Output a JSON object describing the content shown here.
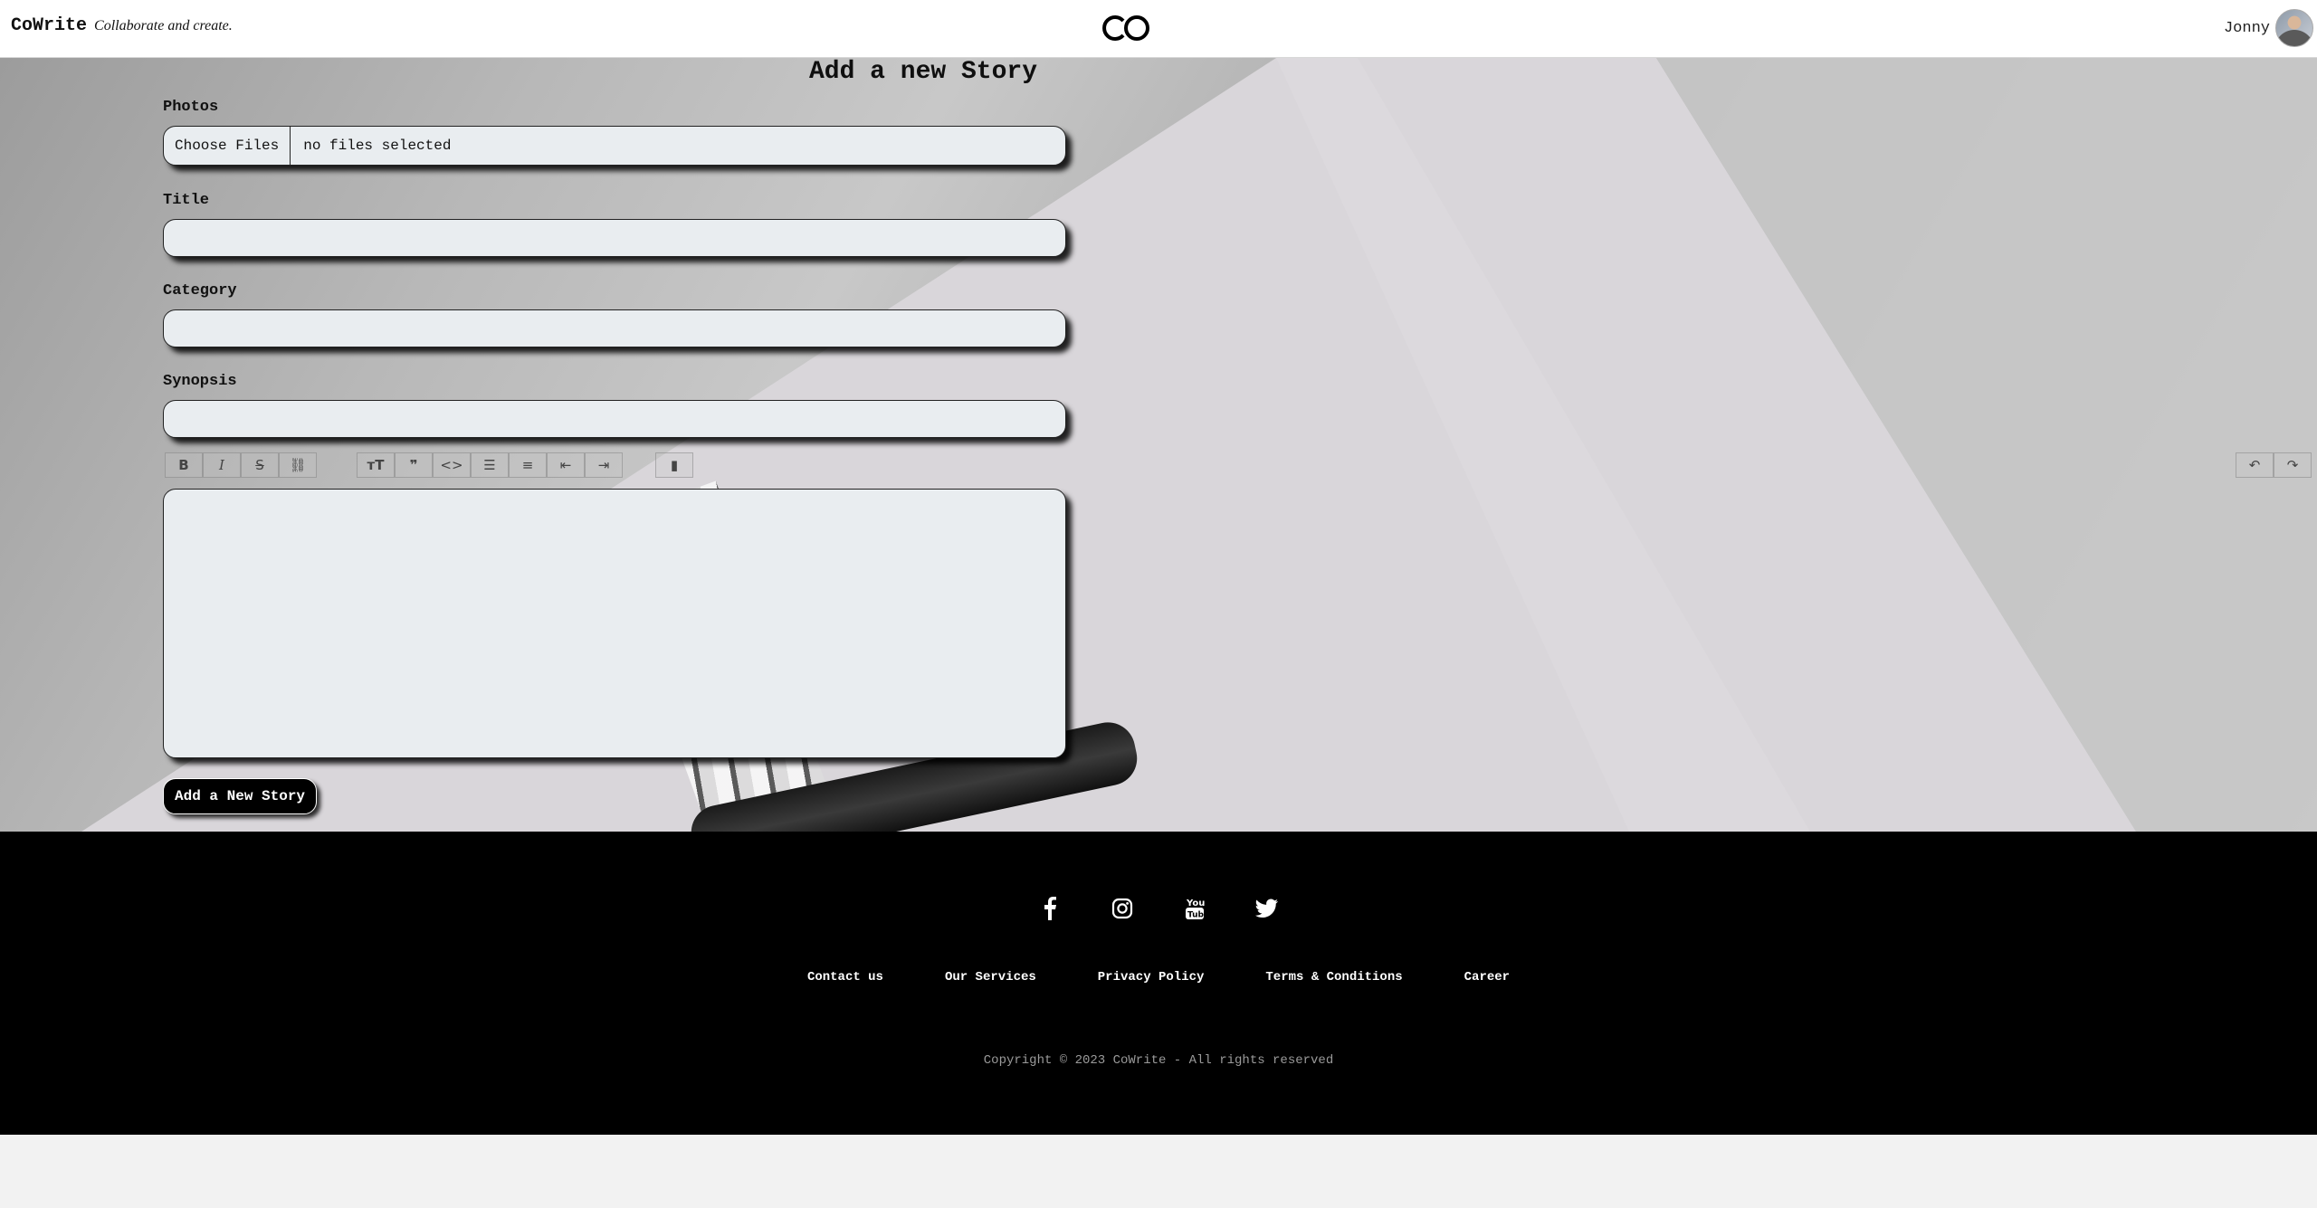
{
  "header": {
    "brand_name": "CoWrite",
    "tagline": "Collaborate and create.",
    "logo_text": "CO",
    "user_name": "Jonny"
  },
  "form": {
    "title": "Add a new Story",
    "photos_label": "Photos",
    "choose_files": "Choose Files",
    "file_status": "no files selected",
    "title_label": "Title",
    "title_value": "",
    "category_label": "Category",
    "category_value": "",
    "synopsis_label": "Synopsis",
    "synopsis_value": "",
    "editor_content": "",
    "submit_label": "Add a New Story"
  },
  "toolbar": {
    "tools": [
      "bold-icon",
      "italic-icon",
      "strikethrough-icon",
      "link-icon",
      "heading-icon",
      "quote-icon",
      "code-icon",
      "bullet-list-icon",
      "numbered-list-icon",
      "outdent-icon",
      "indent-icon",
      "attach-icon",
      "undo-icon",
      "redo-icon"
    ]
  },
  "footer": {
    "social": [
      "facebook-icon",
      "instagram-icon",
      "youtube-icon",
      "twitter-icon"
    ],
    "links": [
      "Contact us",
      "Our Services",
      "Privacy Policy",
      "Terms & Conditions",
      "Career"
    ],
    "copyright": "Copyright © 2023 CoWrite - All rights reserved"
  },
  "colors": {
    "field_bg": "#e9edf0",
    "footer_bg": "#000000",
    "accent": "#000000"
  }
}
